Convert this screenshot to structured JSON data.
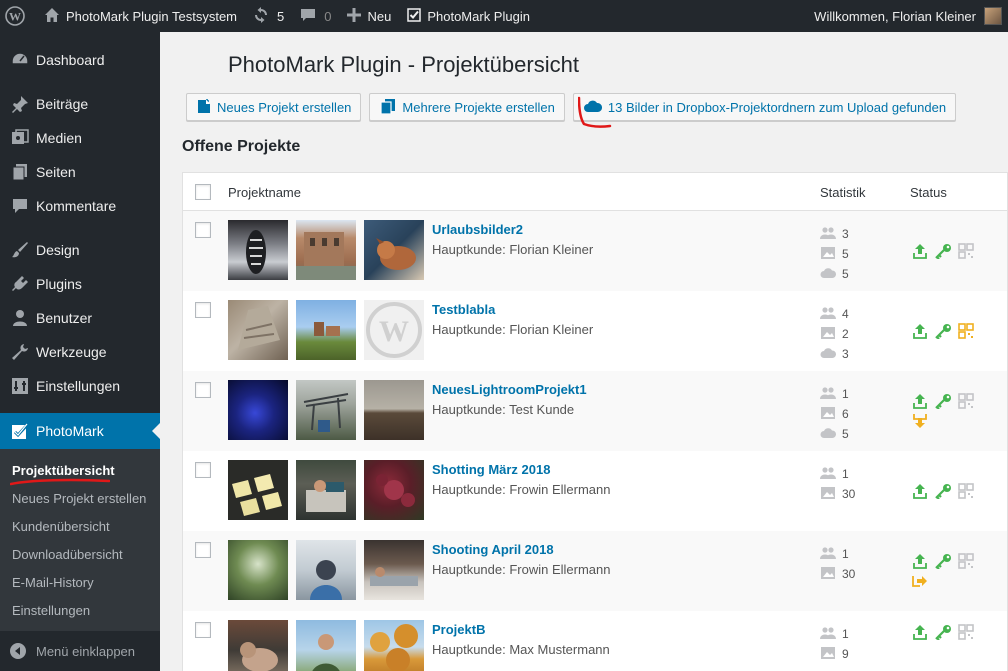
{
  "adminbar": {
    "site_name": "PhotoMark Plugin Testsystem",
    "updates_count": "5",
    "comments_count": "0",
    "new_label": "Neu",
    "plugin_label": "PhotoMark Plugin",
    "greeting": "Willkommen, Florian Kleiner"
  },
  "sidebar": {
    "items": [
      {
        "label": "Dashboard",
        "icon": "dashboard-icon"
      },
      {
        "label": "Beiträge",
        "icon": "pin-icon"
      },
      {
        "label": "Medien",
        "icon": "media-icon"
      },
      {
        "label": "Seiten",
        "icon": "page-icon"
      },
      {
        "label": "Kommentare",
        "icon": "comment-icon"
      },
      {
        "label": "Design",
        "icon": "brush-icon"
      },
      {
        "label": "Plugins",
        "icon": "plugin-icon"
      },
      {
        "label": "Benutzer",
        "icon": "user-icon"
      },
      {
        "label": "Werkzeuge",
        "icon": "wrench-icon"
      },
      {
        "label": "Einstellungen",
        "icon": "settings-icon"
      },
      {
        "label": "PhotoMark",
        "icon": "checkbox-icon"
      }
    ],
    "submenu": [
      "Projektübersicht",
      "Neues Projekt erstellen",
      "Kundenübersicht",
      "Downloadübersicht",
      "E-Mail-History",
      "Einstellungen"
    ],
    "collapse_label": "Menü einklappen"
  },
  "main": {
    "title": "PhotoMark Plugin - Projektübersicht",
    "buttons": {
      "new_project": "Neues Projekt erstellen",
      "multi_project": "Mehrere Projekte erstellen",
      "dropbox": "13 Bilder in Dropbox-Projektordnern zum Upload gefunden"
    },
    "section_title": "Offene Projekte",
    "table": {
      "col_name": "Projektname",
      "col_stat": "Statistik",
      "col_status": "Status"
    },
    "projects": [
      {
        "name": "Urlaubsbilder2",
        "client": "Hauptkunde: Florian Kleiner",
        "persons": "3",
        "images": "5",
        "cloud": "5"
      },
      {
        "name": "Testblabla",
        "client": "Hauptkunde: Florian Kleiner",
        "persons": "4",
        "images": "2",
        "cloud": "3"
      },
      {
        "name": "NeuesLightroomProjekt1",
        "client": "Hauptkunde: Test Kunde",
        "persons": "1",
        "images": "6",
        "cloud": "5"
      },
      {
        "name": "Shotting März 2018",
        "client": "Hauptkunde: Frowin Ellermann",
        "persons": "1",
        "images": "30"
      },
      {
        "name": "Shooting April 2018",
        "client": "Hauptkunde: Frowin Ellermann",
        "persons": "1",
        "images": "30"
      },
      {
        "name": "ProjektB",
        "client": "Hauptkunde: Max Mustermann",
        "persons": "1",
        "images": "9"
      }
    ]
  },
  "colors": {
    "adminbar_bg": "#23282d",
    "accent": "#0073aa",
    "status_green": "#46b450",
    "status_orange": "#f0b020",
    "annotation_red": "#e01818"
  }
}
